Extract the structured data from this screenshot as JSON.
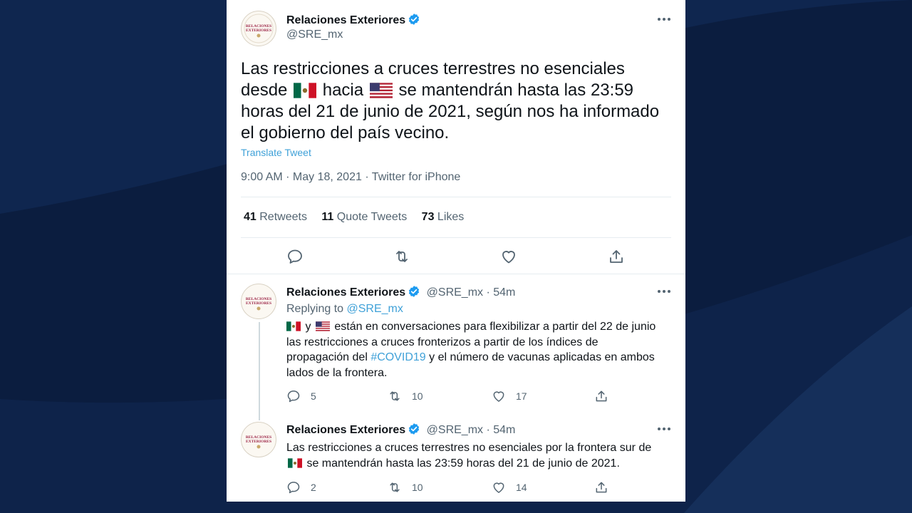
{
  "main_tweet": {
    "author": "Relaciones Exteriores",
    "handle": "@SRE_mx",
    "avatar_text": "RELACIONES EXTERIORES",
    "text_1": "Las restricciones a cruces terrestres no esenciales desde",
    "text_2": "hacia",
    "text_3": "se mantendrán hasta las 23:59 horas del 21 de junio de 2021, según nos ha informado el gobierno del país vecino.",
    "translate": "Translate Tweet",
    "meta": "9:00 AM · May 18, 2021 · Twitter for iPhone",
    "retweets_count": "41",
    "retweets_label": "Retweets",
    "quotes_count": "11",
    "quotes_label": "Quote Tweets",
    "likes_count": "73",
    "likes_label": "Likes"
  },
  "reply1": {
    "author": "Relaciones Exteriores",
    "handle_time": "@SRE_mx · 54m",
    "replying_label": "Replying to",
    "replying_to": "@SRE_mx",
    "text_y": "y",
    "text_a": "están en conversaciones para flexibilizar a partir del 22 de junio las restricciones a cruces fronterizos a partir de los índices de propagación del",
    "hashtag": "#COVID19",
    "text_b": "y el número de vacunas aplicadas en ambos lados de la frontera.",
    "replies": "5",
    "retweets": "10",
    "likes": "17"
  },
  "reply2": {
    "author": "Relaciones Exteriores",
    "handle_time": "@SRE_mx · 54m",
    "text_a": "Las restricciones a cruces terrestres no esenciales por la frontera sur de",
    "text_b": "se mantendrán hasta las 23:59 horas del 21 de junio de 2021.",
    "replies": "2",
    "retweets": "10",
    "likes": "14"
  },
  "colors": {
    "background": "#0b1d3f",
    "link": "#3fa1d8",
    "verified": "#1d9bf0",
    "text": "#0f1419",
    "secondary": "#536471"
  },
  "icons": [
    "reply-icon",
    "retweet-icon",
    "like-icon",
    "share-icon",
    "more-icon",
    "verified-badge-icon",
    "mexico-flag-icon",
    "usa-flag-icon"
  ]
}
